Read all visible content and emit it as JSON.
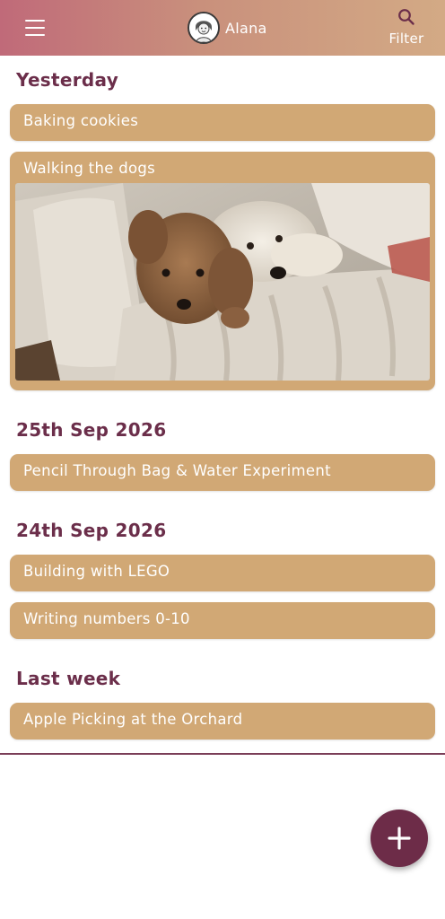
{
  "header": {
    "user_name": "Alana",
    "filter_label": "Filter",
    "icons": {
      "menu": "hamburger-menu-icon",
      "filter": "search-icon",
      "fab": "plus-icon"
    },
    "colors": {
      "gradient_start": "#c06a79",
      "gradient_end": "#d3aa85"
    }
  },
  "sections": [
    {
      "title": "Yesterday",
      "entries": [
        {
          "label": "Baking cookies"
        },
        {
          "label": "Walking the dogs",
          "photo": "two-dogs-on-couch"
        }
      ]
    },
    {
      "title": "25th Sep 2026",
      "entries": [
        {
          "label": "Pencil Through Bag & Water Experiment"
        }
      ]
    },
    {
      "title": "24th Sep 2026",
      "entries": [
        {
          "label": "Building with LEGO"
        },
        {
          "label": "Writing numbers 0-10"
        }
      ]
    },
    {
      "title": "Last week",
      "entries": [
        {
          "label": "Apple Picking at the Orchard"
        }
      ]
    }
  ],
  "theme": {
    "card": "#d1a875",
    "title_text": "#6b2e4a",
    "fab": "#6d2c48"
  }
}
